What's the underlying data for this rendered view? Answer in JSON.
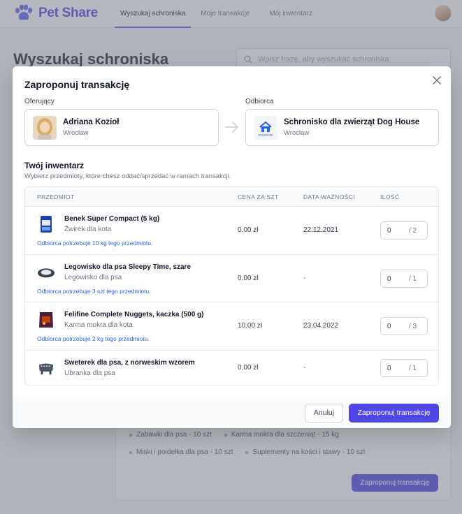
{
  "app": {
    "name": "Pet Share"
  },
  "nav": {
    "tabs": [
      {
        "label": "Wyszukaj schroniska",
        "active": true
      },
      {
        "label": "Moje transakcje",
        "active": false
      },
      {
        "label": "Mój inwentarz",
        "active": false
      }
    ]
  },
  "background": {
    "page_title": "Wyszukaj schroniska",
    "search_placeholder": "Wpisz frazę, aby wyszukać schroniska",
    "needs": [
      "Zabawki dla psa - 10 szt",
      "Karma mokra dla szczeniąt - 15 kg",
      "Miski i poidełka dla psa - 10 szt",
      "Suplementy na kości i stawy - 10 szt"
    ],
    "cta_label": "Zaproponuj transakcję"
  },
  "modal": {
    "title": "Zaproponuj transakcję",
    "offering": {
      "label": "Oferujący",
      "name": "Adriana Kozioł",
      "city": "Wrocław"
    },
    "recipient": {
      "label": "Odbiorca",
      "name": "Schronisko dla zwierząt Dog House",
      "city": "Wrocław",
      "logo_text": "DOGHOUSE"
    },
    "inventory": {
      "title": "Twój inwentarz",
      "subtitle": "Wybierz przedmioty, które chesz oddać/sprzedać w ramach transakcji.",
      "columns": {
        "item": "PRZEDMIOT",
        "price": "CENA ZA SZT",
        "expiry": "DATA WAŻNOŚCI",
        "qty": "ILOŚĆ"
      },
      "rows": [
        {
          "name": "Benek Super Compact (5 kg)",
          "category": "Żwirek dla kota",
          "price": "0.00 zł",
          "expiry": "22.12.2021",
          "qty": "0",
          "max": "/ 2",
          "note": "Odbiorca potrzebuje 10 kg tego przedmiotu."
        },
        {
          "name": "Legowisko dla psa Sleepy Time, szare",
          "category": "Legowisko dla psa",
          "price": "0.00 zł",
          "expiry": "-",
          "qty": "0",
          "max": "/ 1",
          "note": "Odbiorca potrzebuje 3 szt tego przedmiotu."
        },
        {
          "name": "Felifine Complete Nuggets, kaczka (500 g)",
          "category": "Karma mokra dla kota",
          "price": "10.00 zł",
          "expiry": "23.04.2022",
          "qty": "0",
          "max": "/ 3",
          "note": "Odbiorca potrzebuje 2 kg tego przedmiotu."
        },
        {
          "name": "Sweterek dla psa, z norweskim wzorem",
          "category": "Ubranka dla psa",
          "price": "0.00 zł",
          "expiry": "-",
          "qty": "0",
          "max": "/ 1",
          "note": ""
        }
      ]
    },
    "buttons": {
      "cancel": "Anuluj",
      "submit": "Zaproponuj transakcję"
    }
  },
  "colors": {
    "accent": "#4f46e5",
    "note": "#2563eb"
  }
}
